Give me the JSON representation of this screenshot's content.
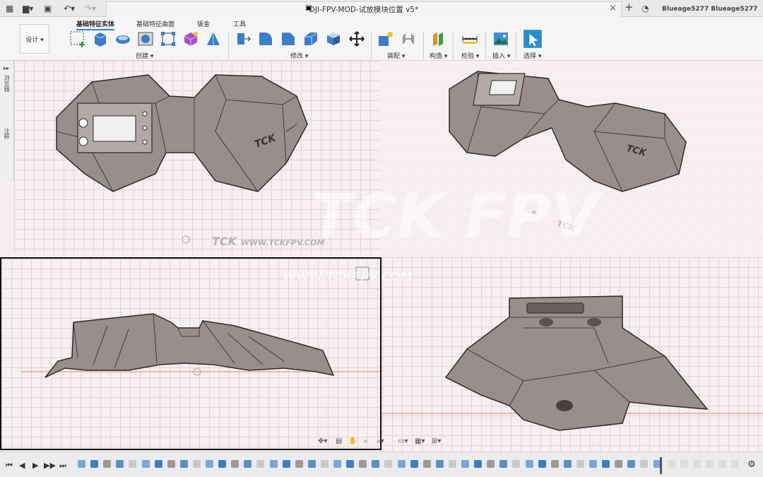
{
  "titlebar": {
    "document_title": "DJI-FPV-MOD-试放模块位置 v5*",
    "close_symbol": "×",
    "new_tab_symbol": "+",
    "user_names": "Blueage5277 Blueage5277"
  },
  "toolbar": {
    "tabs": [
      "基础特征实体",
      "基础特征曲面",
      "钣金",
      "工具"
    ],
    "workspace_button": "设计 ▾",
    "groups": [
      "创建 ▾",
      "修改 ▾",
      "装配 ▾",
      "构造 ▾",
      "检验 ▾",
      "插入 ▾",
      "选择 ▾"
    ]
  },
  "side_panel": {
    "browser_label": "浏览器",
    "comments_label": "注释"
  },
  "viewports": {
    "logo_text": "TCK",
    "watermark_big": "TCK FPV",
    "watermark_url": "WWW.TCKFPV.COM"
  },
  "nav_icons": [
    "orbit-icon",
    "pan-icon",
    "hand-icon",
    "zoom-icon",
    "fit-icon",
    "display-icon",
    "grid-icon",
    "layout-icon"
  ],
  "timeline": {
    "controls": [
      "⏮",
      "◀",
      "▶",
      "▶▶",
      "⏭"
    ],
    "settings_symbol": "⚙"
  },
  "colors": {
    "accent": "#2a7fd4",
    "model_fill": "#9a8d8d",
    "model_edge": "#2b2b2b",
    "grid": "#e3d3d6",
    "ground_line": "#d98a6a"
  }
}
